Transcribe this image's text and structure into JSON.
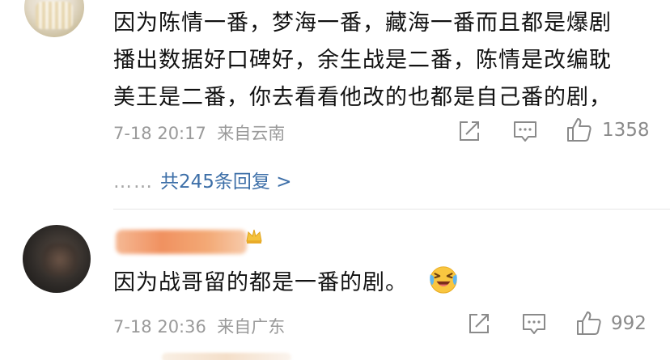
{
  "comment": {
    "lines": [
      "因为陈情一番，梦海一番，藏海一番而且都是爆剧",
      "播出数据好口碑好，余生战是二番，陈情是改编耽",
      "美王是二番，你去看看他改的也都是自己番的剧，"
    ],
    "date": "7-18 20:17",
    "location": "来自云南",
    "like_count": "1358",
    "replies": {
      "dots": "……",
      "label": "共245条回复 >"
    }
  },
  "reply": {
    "text": "因为战哥留的都是一番的剧。",
    "date": "7-18 20:36",
    "location": "来自广东",
    "like_count": "992"
  },
  "colors": {
    "text": "#111111",
    "meta": "#9a9a9a",
    "link": "#3d6fa8",
    "icon": "#8a8a8a"
  },
  "icons": [
    "share-icon",
    "comment-icon",
    "like-icon",
    "laughing-crying-emoji"
  ]
}
